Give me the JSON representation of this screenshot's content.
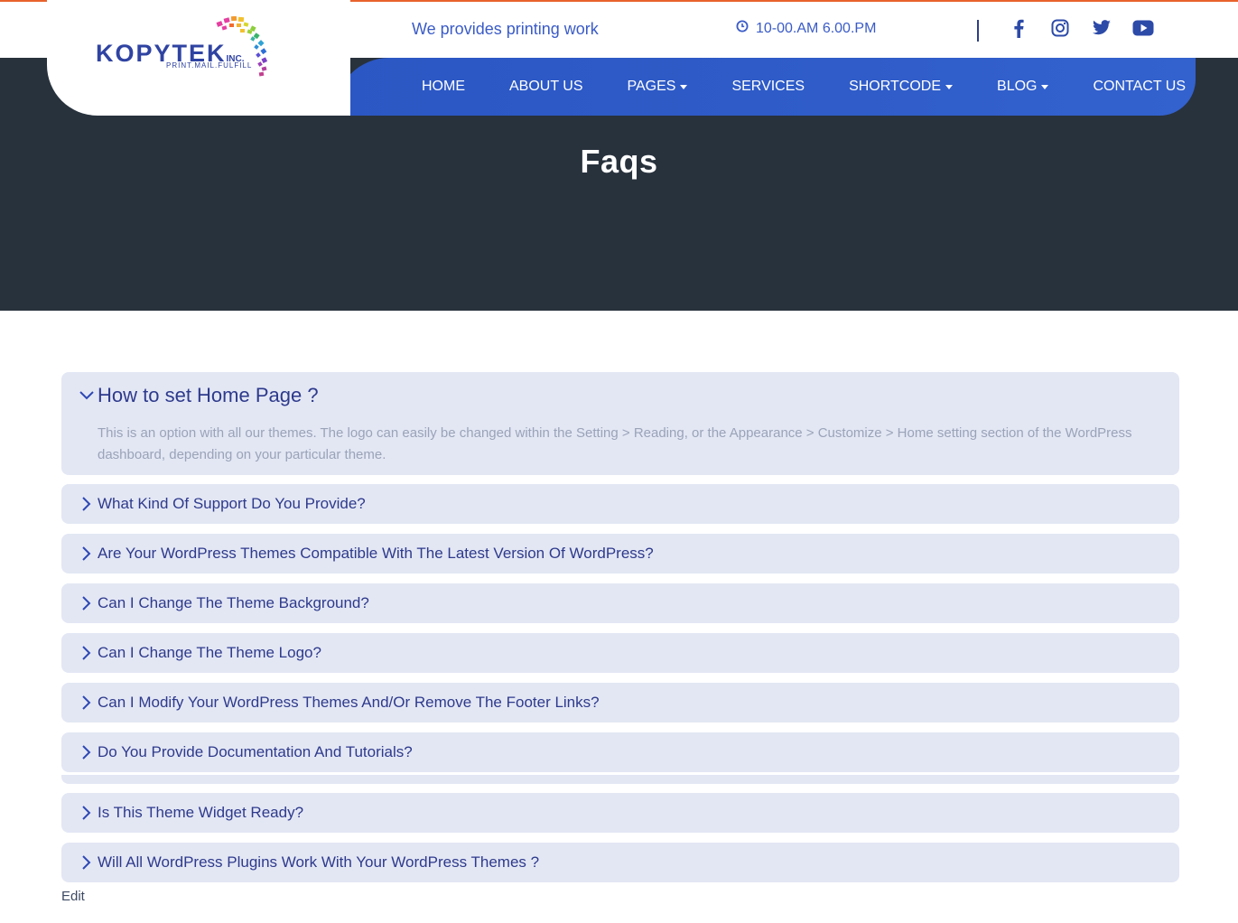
{
  "brand": {
    "name": "KOPYTEK",
    "suffix": "INC.",
    "tagline_small": "PRINT.MAIL.FULFILL"
  },
  "topbar": {
    "tagline": "We provides printing work",
    "hours": "10-00.AM 6.00.PM",
    "social": [
      "facebook-icon",
      "instagram-icon",
      "twitter-icon",
      "youtube-icon"
    ]
  },
  "nav": {
    "items": [
      {
        "label": "HOME",
        "dropdown": false
      },
      {
        "label": "ABOUT US",
        "dropdown": false
      },
      {
        "label": "PAGES",
        "dropdown": true
      },
      {
        "label": "SERVICES",
        "dropdown": false
      },
      {
        "label": "SHORTCODE",
        "dropdown": true
      },
      {
        "label": "BLOG",
        "dropdown": true
      },
      {
        "label": "CONTACT US",
        "dropdown": false
      }
    ]
  },
  "hero": {
    "title": "Faqs"
  },
  "faqs": [
    {
      "question": "How to set Home Page ?",
      "open": true,
      "answer": "This is an option with all our themes. The logo can easily be changed within the Setting > Reading, or the Appearance > Customize > Home setting section of the WordPress dashboard, depending on your particular theme."
    },
    {
      "question": "What Kind Of Support Do You Provide?",
      "open": false
    },
    {
      "question": "Are Your WordPress Themes Compatible With The Latest Version Of WordPress?",
      "open": false
    },
    {
      "question": "Can I Change The Theme Background?",
      "open": false
    },
    {
      "question": "Can I Change The Theme Logo?",
      "open": false
    },
    {
      "question": "Can I Modify Your WordPress Themes And/Or Remove The Footer Links?",
      "open": false
    },
    {
      "question": "Do You Provide Documentation And Tutorials?",
      "open": false
    },
    {
      "question": "Is This Theme Widget Ready?",
      "open": false
    },
    {
      "question": "Will All WordPress Plugins Work With Your WordPress Themes ?",
      "open": false
    }
  ],
  "footer": {
    "edit_label": "Edit"
  },
  "colors": {
    "accent_orange": "#e8622c",
    "nav_blue": "#2f5cc8",
    "hero_dark": "#28323d",
    "faq_bg": "#e3e7f4",
    "faq_text": "#2e3a8c"
  }
}
